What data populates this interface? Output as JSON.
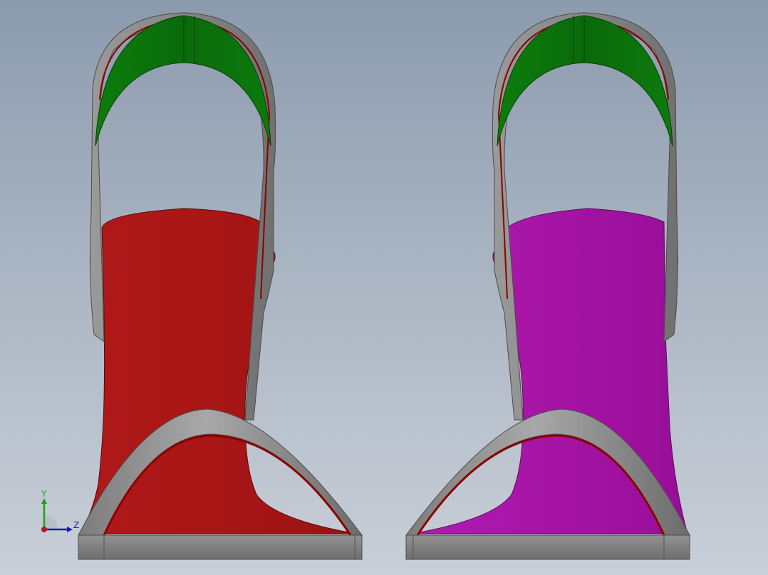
{
  "viewport": {
    "background_top": "#8b9bae",
    "background_bottom": "#c9cfd8"
  },
  "models": [
    {
      "name": "left-sandal",
      "body_color": "#a01414",
      "strap_color": "#0b700b",
      "frame_color": "#8c8c8c",
      "edge_color": "#8b0000"
    },
    {
      "name": "right-sandal",
      "body_color": "#a412a4",
      "strap_color": "#0b700b",
      "frame_color": "#8c8c8c",
      "edge_color": "#8b0000"
    }
  ],
  "triad": {
    "y_label": "Y",
    "z_label": "Z",
    "y_color": "#1aa31a",
    "z_color": "#1a1ab3",
    "origin_color": "#c01818"
  }
}
